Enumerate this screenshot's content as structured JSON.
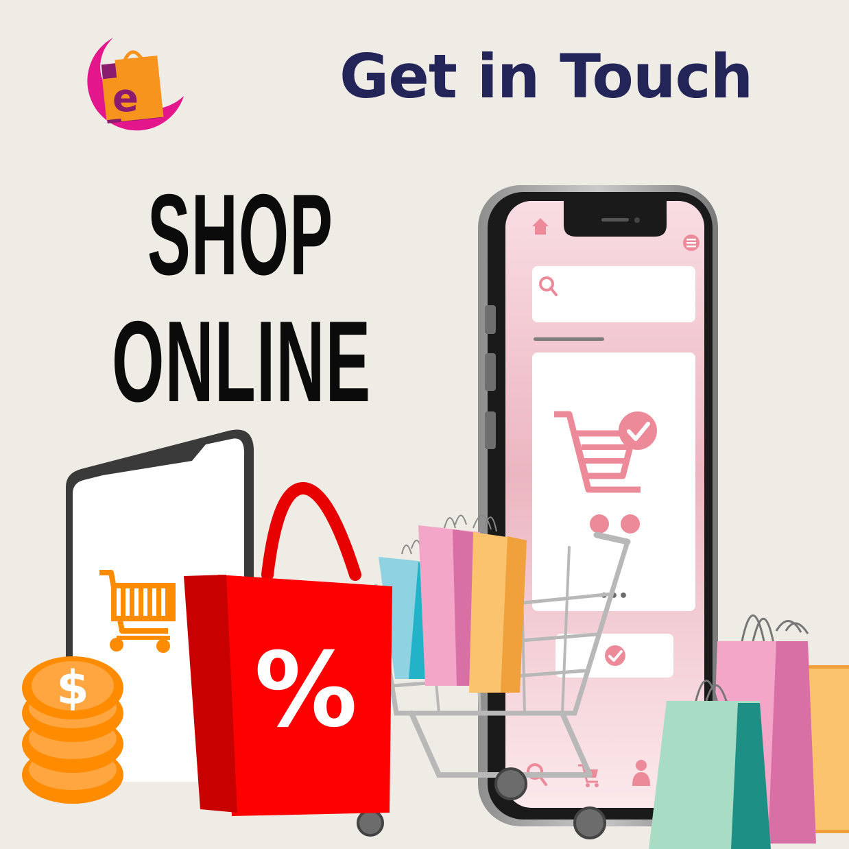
{
  "header": {
    "logo_letter": "e",
    "logo_name": "shopping-bag-logo",
    "cta_text": "Get in Touch"
  },
  "hero": {
    "line1": "SHOP",
    "line2": "ONLINE"
  },
  "phone_screen": {
    "icons": [
      "home-icon",
      "menu-icon",
      "search-icon",
      "cart-check-icon",
      "check-icon",
      "nav-search-icon",
      "nav-cart-icon",
      "nav-profile-icon"
    ],
    "more_dots": "•••"
  },
  "sale_bag": {
    "label": "%"
  },
  "coins": {
    "symbol": "$"
  },
  "colors": {
    "background": "#efebe5",
    "headline": "#232558",
    "screen_pink": "#f2c9d2",
    "accent_pink": "#ec8a9a",
    "sale_red": "#ff0000",
    "coin_orange": "#ff8c00",
    "logo_magenta": "#e3178b",
    "logo_purple": "#8b1b6e",
    "logo_orange": "#f7941d"
  }
}
